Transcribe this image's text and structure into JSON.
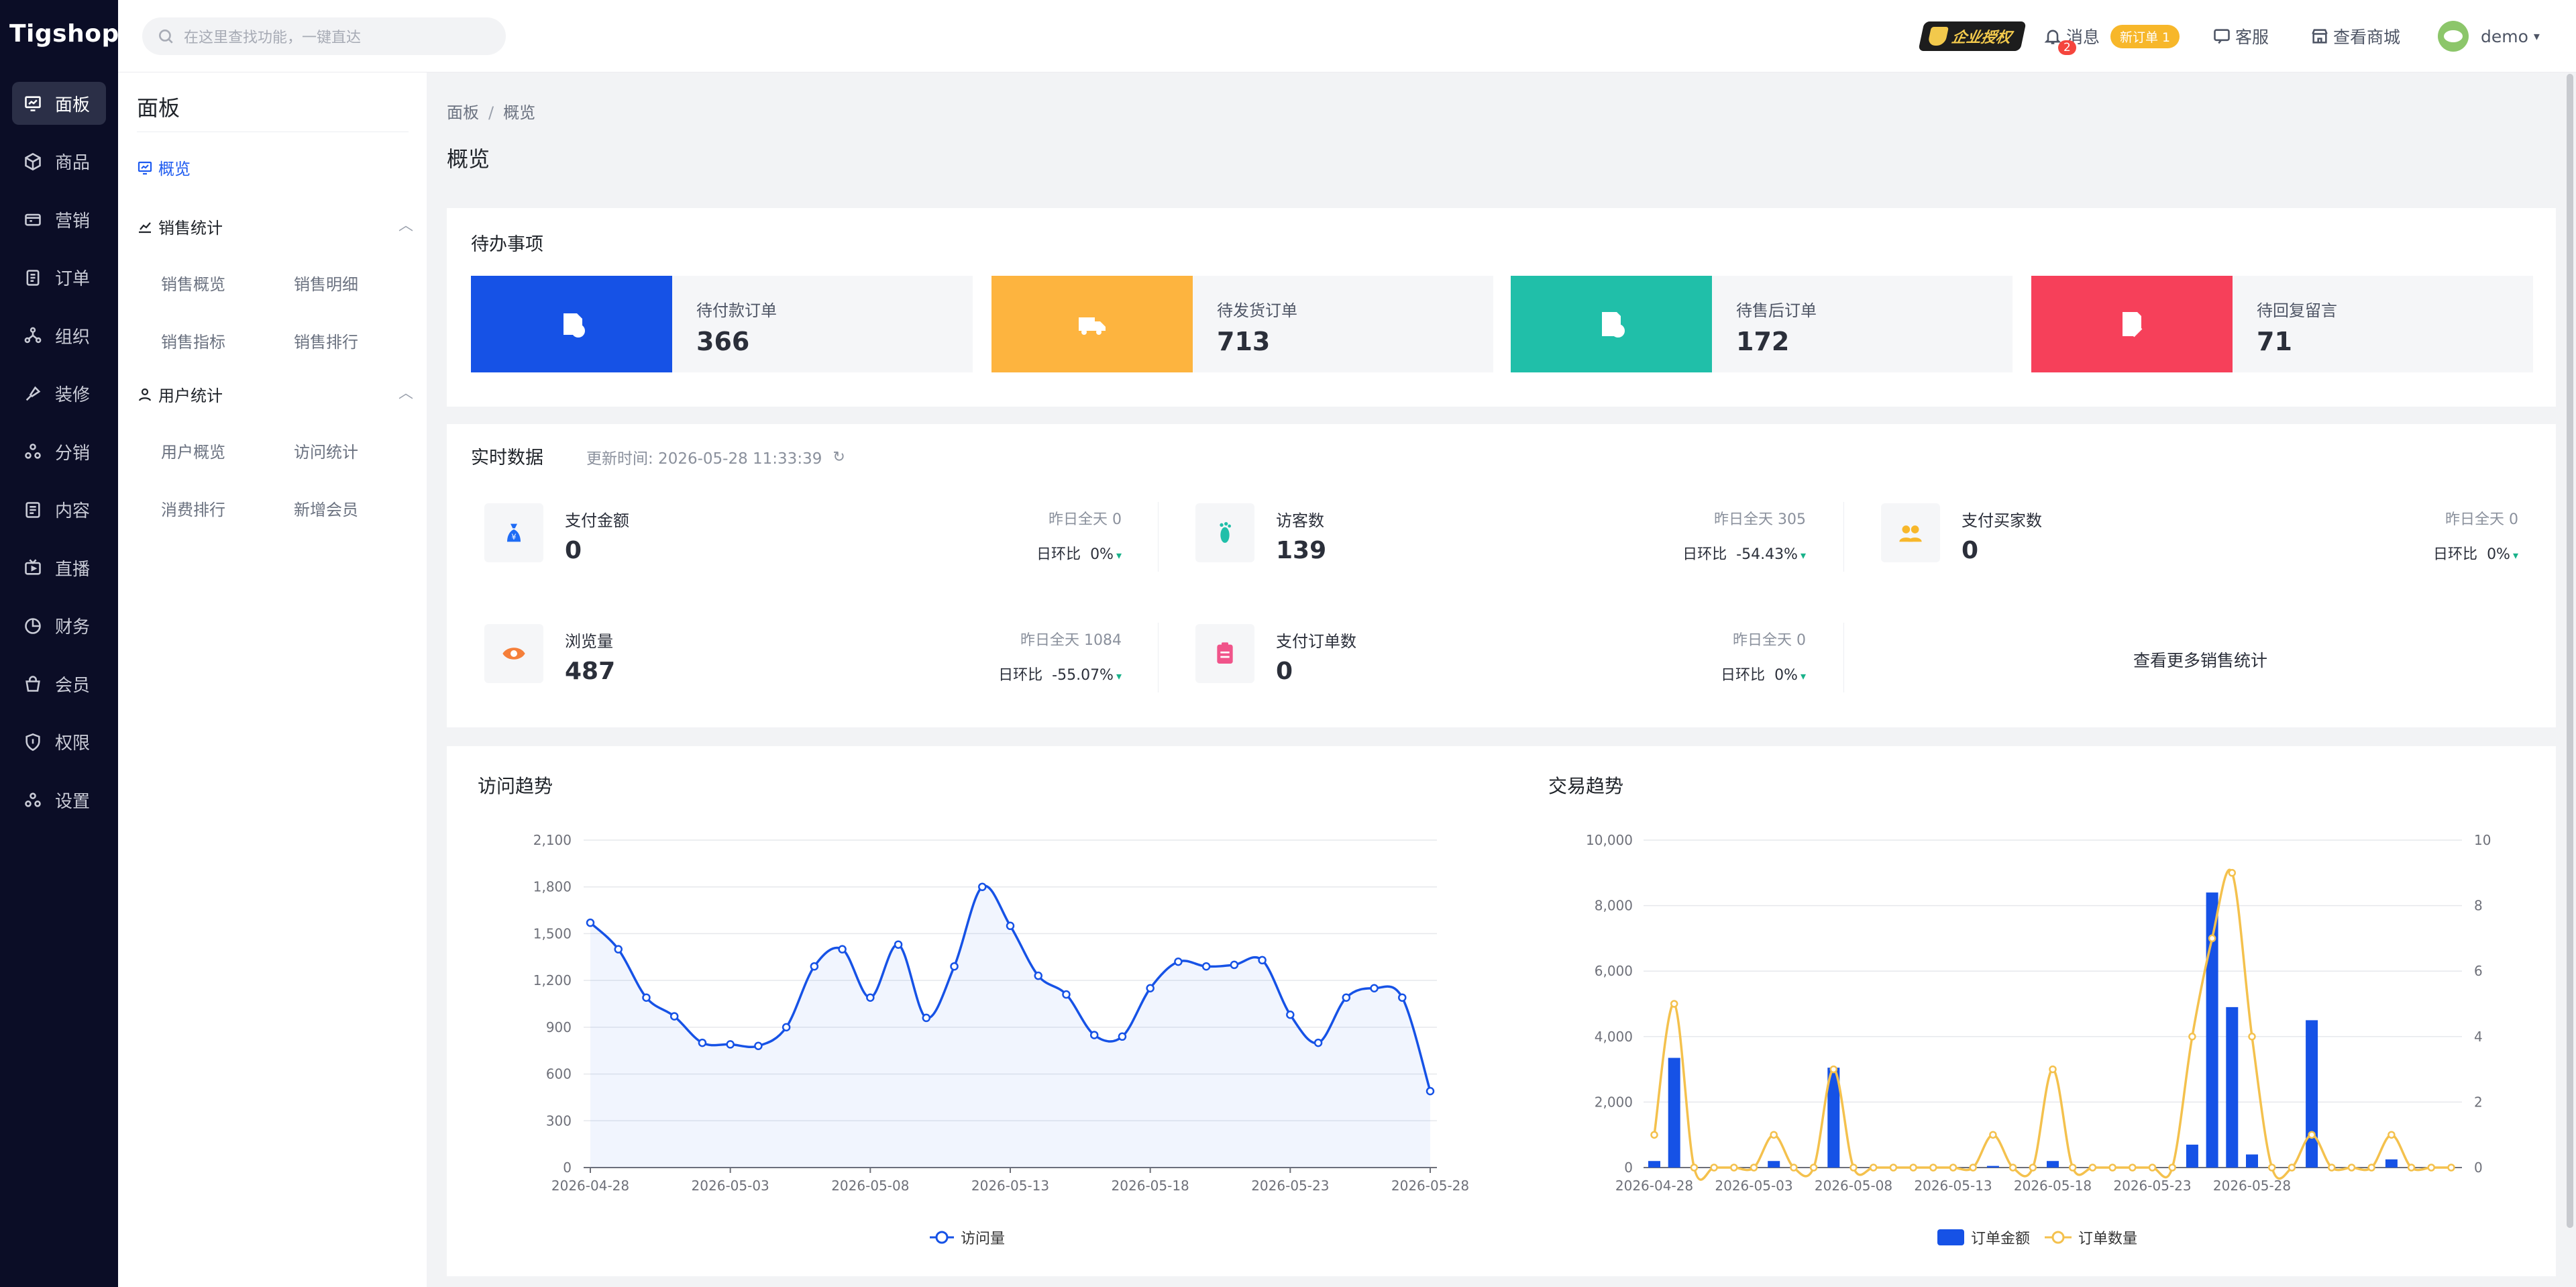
{
  "app": {
    "logo": "Tigshop"
  },
  "rail": [
    {
      "label": "面板",
      "icon": "dashboard-icon",
      "active": true
    },
    {
      "label": "商品",
      "icon": "box-icon"
    },
    {
      "label": "营销",
      "icon": "megaphone-icon"
    },
    {
      "label": "订单",
      "icon": "order-icon"
    },
    {
      "label": "组织",
      "icon": "org-icon"
    },
    {
      "label": "装修",
      "icon": "paint-icon"
    },
    {
      "label": "分销",
      "icon": "share-icon"
    },
    {
      "label": "内容",
      "icon": "content-icon"
    },
    {
      "label": "直播",
      "icon": "live-icon"
    },
    {
      "label": "财务",
      "icon": "finance-icon"
    },
    {
      "label": "会员",
      "icon": "member-icon"
    },
    {
      "label": "权限",
      "icon": "shield-icon"
    },
    {
      "label": "设置",
      "icon": "settings-icon"
    }
  ],
  "topbar": {
    "search_placeholder": "在这里查找功能，一键直达",
    "auth_label": "企业授权",
    "message_label": "消息",
    "message_badge": "2",
    "new_order_badge": "新订单 1",
    "service_label": "客服",
    "shop_label": "查看商城",
    "user_label": "demo"
  },
  "sidebar": {
    "title": "面板",
    "overview": "概览",
    "sales_stats": "销售统计",
    "sales_items": [
      "销售概览",
      "销售明细",
      "销售指标",
      "销售排行"
    ],
    "user_stats": "用户统计",
    "user_items": [
      "用户概览",
      "访问统计",
      "消费排行",
      "新增会员"
    ]
  },
  "breadcrumb": {
    "root": "面板",
    "sep": "/",
    "current": "概览"
  },
  "page_title": "概览",
  "todo": {
    "title": "待办事项",
    "items": [
      {
        "label": "待付款订单",
        "value": "366",
        "color": "#1652e6",
        "icon": "payment-doc-icon"
      },
      {
        "label": "待发货订单",
        "value": "713",
        "color": "#fdb43f",
        "icon": "truck-icon"
      },
      {
        "label": "待售后订单",
        "value": "172",
        "color": "#20bfa9",
        "icon": "refund-doc-icon"
      },
      {
        "label": "待回复留言",
        "value": "71",
        "color": "#f6405a",
        "icon": "edit-note-icon"
      }
    ]
  },
  "realtime": {
    "title": "实时数据",
    "updated": "更新时间: 2026-05-28 11:33:39",
    "yesterday_prefix": "昨日全天",
    "dod_label": "日环比",
    "metrics": [
      {
        "name": "支付金额",
        "value": "0",
        "yesterday": "0",
        "dod": "0%",
        "icon": "money-bag-icon"
      },
      {
        "name": "访客数",
        "value": "139",
        "yesterday": "305",
        "dod": "-54.43%",
        "icon": "footprint-icon"
      },
      {
        "name": "支付买家数",
        "value": "0",
        "yesterday": "0",
        "dod": "0%",
        "icon": "buyers-icon"
      },
      {
        "name": "浏览量",
        "value": "487",
        "yesterday": "1084",
        "dod": "-55.07%",
        "icon": "eye-icon"
      },
      {
        "name": "支付订单数",
        "value": "0",
        "yesterday": "0",
        "dod": "0%",
        "icon": "clipboard-icon"
      }
    ],
    "more": "查看更多销售统计"
  },
  "chart_data": [
    {
      "type": "line",
      "title": "访问趋势",
      "series": [
        {
          "name": "访问量",
          "values": [
            1570,
            1400,
            1090,
            970,
            800,
            790,
            780,
            900,
            1290,
            1400,
            1090,
            1430,
            960,
            1290,
            1800,
            1550,
            1230,
            1110,
            850,
            840,
            1150,
            1320,
            1290,
            1300,
            1330,
            980,
            800,
            1090,
            1150,
            1090,
            490
          ]
        }
      ],
      "x_ticks": [
        "2026-04-28",
        "2026-05-03",
        "2026-05-08",
        "2026-05-13",
        "2026-05-18",
        "2026-05-23",
        "2026-05-28"
      ],
      "y_ticks": [
        "0",
        "300",
        "600",
        "900",
        "1,200",
        "1,500",
        "1,800",
        "2,100"
      ],
      "ylim": [
        0,
        2100
      ],
      "color": "#1652e6"
    },
    {
      "type": "bar",
      "title": "交易趋势",
      "series": [
        {
          "name": "订单金额",
          "type": "bar",
          "axis": "left",
          "values": [
            200,
            3350,
            0,
            0,
            0,
            0,
            200,
            0,
            0,
            3050,
            0,
            0,
            0,
            0,
            0,
            0,
            0,
            50,
            0,
            0,
            200,
            0,
            0,
            0,
            0,
            0,
            0,
            700,
            8400,
            4900,
            400,
            0,
            0,
            4500,
            0,
            0,
            0,
            250,
            0,
            0,
            0
          ]
        },
        {
          "name": "订单数量",
          "type": "line",
          "axis": "right",
          "values": [
            1,
            5,
            0,
            0,
            0,
            0,
            1,
            0,
            0,
            3,
            0,
            0,
            0,
            0,
            0,
            0,
            0,
            1,
            0,
            0,
            3,
            0,
            0,
            0,
            0,
            0,
            0,
            4,
            7,
            9,
            4,
            0,
            0,
            1,
            0,
            0,
            0,
            1,
            0,
            0,
            0
          ]
        }
      ],
      "x_ticks": [
        "2026-04-28",
        "2026-05-03",
        "2026-05-08",
        "2026-05-13",
        "2026-05-18",
        "2026-05-23",
        "2026-05-28"
      ],
      "y_ticks_left": [
        "0",
        "2,000",
        "4,000",
        "6,000",
        "8,000",
        "10,000"
      ],
      "y_ticks_right": [
        "0",
        "2",
        "4",
        "6",
        "8",
        "10"
      ],
      "ylim_left": [
        0,
        10000
      ],
      "ylim_right": [
        0,
        10
      ],
      "bar_color": "#1652e6",
      "line_color": "#f4c14d"
    }
  ]
}
